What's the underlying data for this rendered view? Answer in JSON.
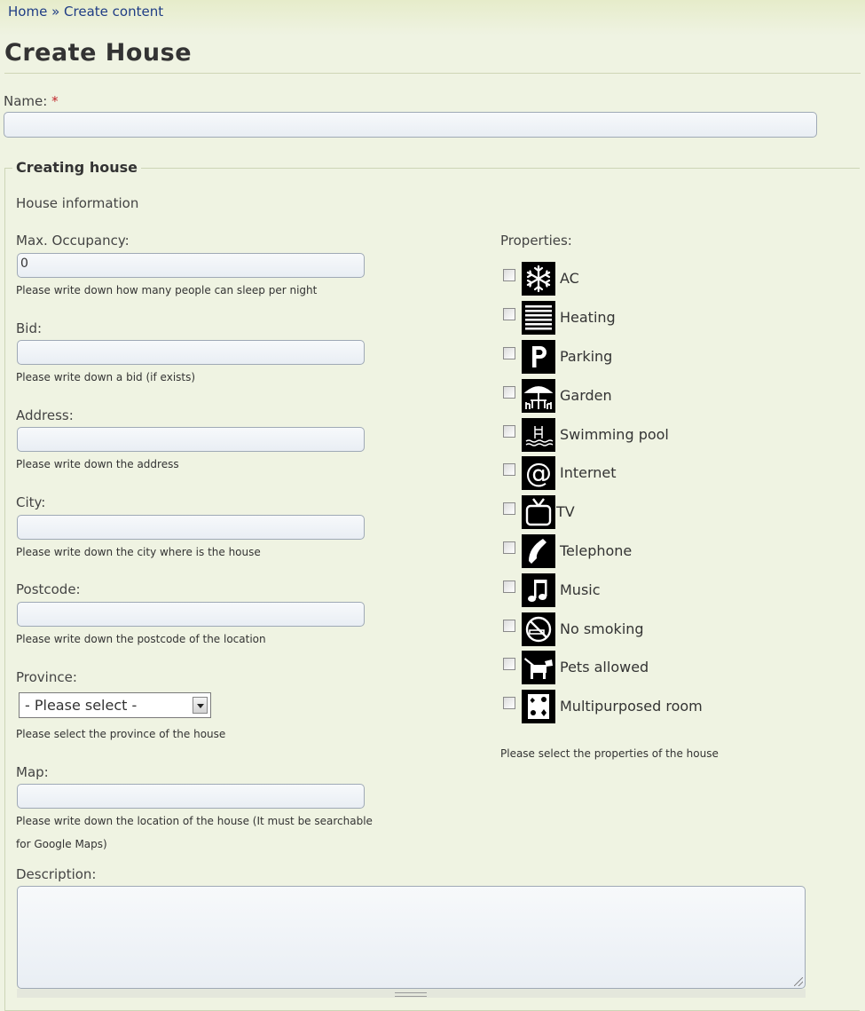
{
  "breadcrumb": {
    "home": "Home",
    "separator": "»",
    "current": "Create content"
  },
  "page_title": "Create House",
  "name_field": {
    "label": "Name:",
    "required_mark": "*",
    "value": ""
  },
  "fieldset": {
    "legend": "Creating house",
    "section_heading": "House information",
    "fields": {
      "max_occupancy": {
        "label": "Max. Occupancy:",
        "value": "0",
        "help": "Please write down how many people can sleep per night"
      },
      "bid": {
        "label": "Bid:",
        "value": "",
        "help": "Please write down a bid (if exists)"
      },
      "address": {
        "label": "Address:",
        "value": "",
        "help": "Please write down the address"
      },
      "city": {
        "label": "City:",
        "value": "",
        "help": "Please write down the city where is the house"
      },
      "postcode": {
        "label": "Postcode:",
        "value": "",
        "help": "Please write down the postcode of the location"
      },
      "province": {
        "label": "Province:",
        "selected": "- Please select -",
        "help": "Please select the province of the house"
      },
      "map": {
        "label": "Map:",
        "value": "",
        "help_line1": "Please write down the location of the house (It must be searchable",
        "help_line2": "for Google Maps)"
      },
      "description": {
        "label": "Description:",
        "value": ""
      }
    },
    "properties": {
      "label": "Properties:",
      "help": "Please select the properties of the house",
      "items": [
        {
          "label": "AC",
          "icon": "snowflake-icon",
          "checked": false
        },
        {
          "label": "Heating",
          "icon": "heating-icon",
          "checked": false
        },
        {
          "label": "Parking",
          "icon": "parking-icon",
          "checked": false
        },
        {
          "label": "Garden",
          "icon": "garden-icon",
          "checked": false
        },
        {
          "label": "Swimming pool",
          "icon": "swimming-pool-icon",
          "checked": false
        },
        {
          "label": "Internet",
          "icon": "internet-icon",
          "checked": false
        },
        {
          "label": "TV",
          "icon": "tv-icon",
          "checked": false
        },
        {
          "label": "Telephone",
          "icon": "telephone-icon",
          "checked": false
        },
        {
          "label": "Music",
          "icon": "music-icon",
          "checked": false
        },
        {
          "label": "No smoking",
          "icon": "no-smoking-icon",
          "checked": false
        },
        {
          "label": "Pets allowed",
          "icon": "pets-allowed-icon",
          "checked": false
        },
        {
          "label": "Multipurposed room",
          "icon": "multipurpose-room-icon",
          "checked": false
        }
      ]
    }
  },
  "colors": {
    "background": "#eff3e2",
    "link": "#1f3d85",
    "required": "#c0262c",
    "input_border": "#9fa9b6"
  }
}
